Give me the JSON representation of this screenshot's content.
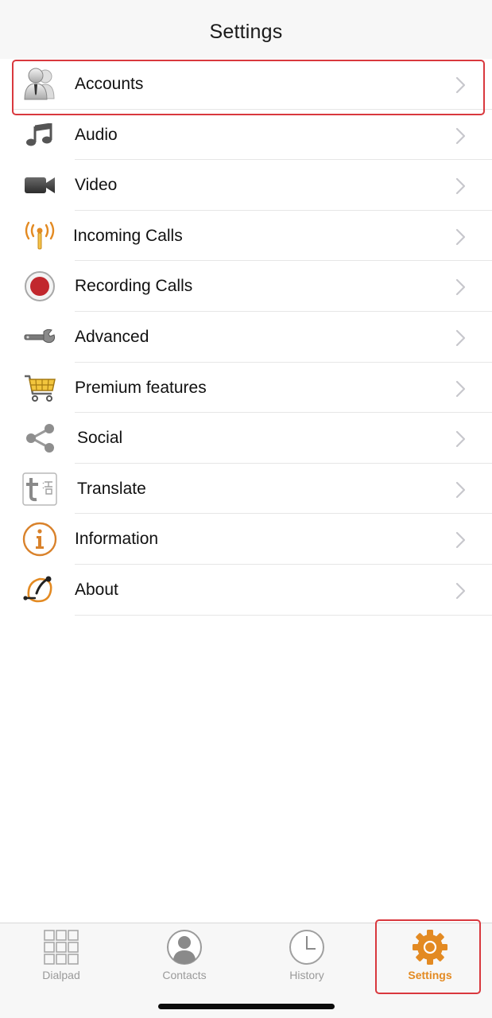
{
  "header": {
    "title": "Settings"
  },
  "settings_items": [
    {
      "label": "Accounts",
      "icon": "accounts-icon"
    },
    {
      "label": "Audio",
      "icon": "music-note-icon"
    },
    {
      "label": "Video",
      "icon": "video-camera-icon"
    },
    {
      "label": "Incoming Calls",
      "icon": "antenna-icon"
    },
    {
      "label": "Recording Calls",
      "icon": "record-icon"
    },
    {
      "label": "Advanced",
      "icon": "wrench-icon"
    },
    {
      "label": "Premium features",
      "icon": "shopping-cart-icon"
    },
    {
      "label": "Social",
      "icon": "share-icon"
    },
    {
      "label": "Translate",
      "icon": "translate-icon"
    },
    {
      "label": "Information",
      "icon": "info-icon"
    },
    {
      "label": "About",
      "icon": "about-icon"
    }
  ],
  "tabbar": {
    "tabs": [
      {
        "label": "Dialpad",
        "icon": "dialpad-icon",
        "active": false
      },
      {
        "label": "Contacts",
        "icon": "contacts-icon",
        "active": false
      },
      {
        "label": "History",
        "icon": "clock-icon",
        "active": false
      },
      {
        "label": "Settings",
        "icon": "gear-icon",
        "active": true
      }
    ]
  },
  "colors": {
    "accent": "#e38a22",
    "highlight_border": "#d9383e",
    "inactive_tab": "#9a9a9a",
    "separator": "#e6e6e6"
  }
}
